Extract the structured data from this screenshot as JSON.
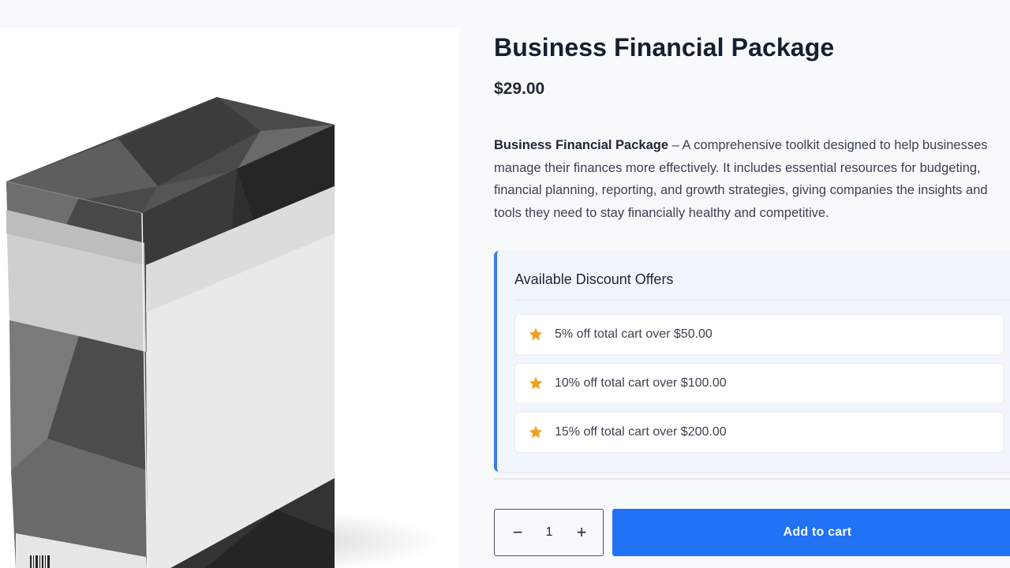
{
  "product": {
    "title": "Business Financial Package",
    "price": "$29.00",
    "description_bold": "Business Financial Package",
    "description_rest": " – A comprehensive toolkit designed to help businesses manage their finances more effectively. It includes essential resources for budgeting, financial planning, reporting, and growth strategies, giving companies the insights and tools they need to stay financially healthy and competitive."
  },
  "offers": {
    "title": "Available Discount Offers",
    "icon": "star-icon",
    "star_color": "#f0a020",
    "items": [
      {
        "label": "5% off total cart over $50.00"
      },
      {
        "label": "10% off total cart over $100.00"
      },
      {
        "label": "15% off total cart over $200.00"
      }
    ]
  },
  "cart": {
    "quantity": "1",
    "minus_label": "−",
    "plus_label": "+",
    "add_label": "Add to cart",
    "accent": "#2172f5"
  }
}
